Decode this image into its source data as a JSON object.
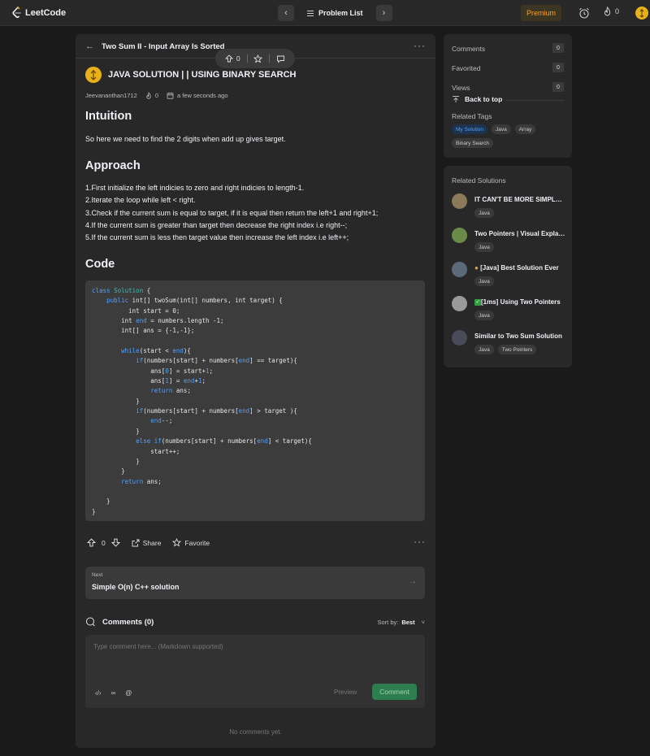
{
  "topbar": {
    "logo_text": "LeetCode",
    "problem_list_label": "Problem List",
    "premium_label": "Premium",
    "streak_count": "0"
  },
  "problem": {
    "title": "Two Sum II - Input Array Is Sorted",
    "upvotes": "0"
  },
  "solution": {
    "title": "JAVA SOLUTION | | USING BINARY SEARCH",
    "author": "Jeevananthan1712",
    "views": "0",
    "posted": "a few seconds ago",
    "intuition_heading": "Intuition",
    "intuition_text": "So here we need to find the 2 digits when add up gives target.",
    "approach_heading": "Approach",
    "approach_lines": [
      "1.First initialize the left indicies to zero and right indicies to length-1.",
      "2.Iterate the loop while left < right.",
      "3.Check if the current sum is equal to target, if it is equal then return the left+1 and right+1;",
      "4.If the current sum is greater than target then decrease the right index i.e right--;",
      "5.If the current sum is less then target value then increase the left index i.e left++;"
    ],
    "code_heading": "Code"
  },
  "actions": {
    "votes": "0",
    "share_label": "Share",
    "favorite_label": "Favorite"
  },
  "next": {
    "label": "Next",
    "title": "Simple O(n) C++ solution"
  },
  "comments": {
    "title": "Comments (0)",
    "sort_label": "Sort by:",
    "sort_value": "Best",
    "placeholder": "Type comment here... (Markdown supported)",
    "preview_label": "Preview",
    "comment_label": "Comment",
    "empty_text": "No comments yet."
  },
  "sidebar": {
    "stats": [
      {
        "label": "Comments",
        "value": "0"
      },
      {
        "label": "Favorited",
        "value": "0"
      },
      {
        "label": "Views",
        "value": "0"
      }
    ],
    "back_to_top": "Back to top",
    "related_tags_heading": "Related Tags",
    "tags": [
      "My Solution",
      "Java",
      "Array",
      "Binary Search"
    ],
    "related_solutions_heading": "Related Solutions",
    "related_solutions": [
      {
        "title": "IT CAN'T BE MORE SIMPLER THAN THIS",
        "tags": [
          "Java"
        ],
        "avatar_color": "#8a7a5a"
      },
      {
        "title": "Two Pointers | Visual Explanation",
        "tags": [
          "Java"
        ],
        "avatar_color": "#6a8a4a"
      },
      {
        "title": "[Java] Best Solution Ever",
        "tags": [
          "Java"
        ],
        "avatar_color": "#5a6a7a"
      },
      {
        "title": "[1ms] Using Two Pointers",
        "tags": [
          "Java"
        ],
        "avatar_color": "#9a9a9a"
      },
      {
        "title": "Similar to Two Sum Solution",
        "tags": [
          "Java",
          "Two Pointers"
        ],
        "avatar_color": "#4a4a5a"
      }
    ]
  },
  "colors": {
    "background": "#1a1a1a",
    "panel": "#282828",
    "accent_orange": "#ffa116",
    "accent_green": "#2e7d4f",
    "link_blue": "#4fa1ff"
  }
}
